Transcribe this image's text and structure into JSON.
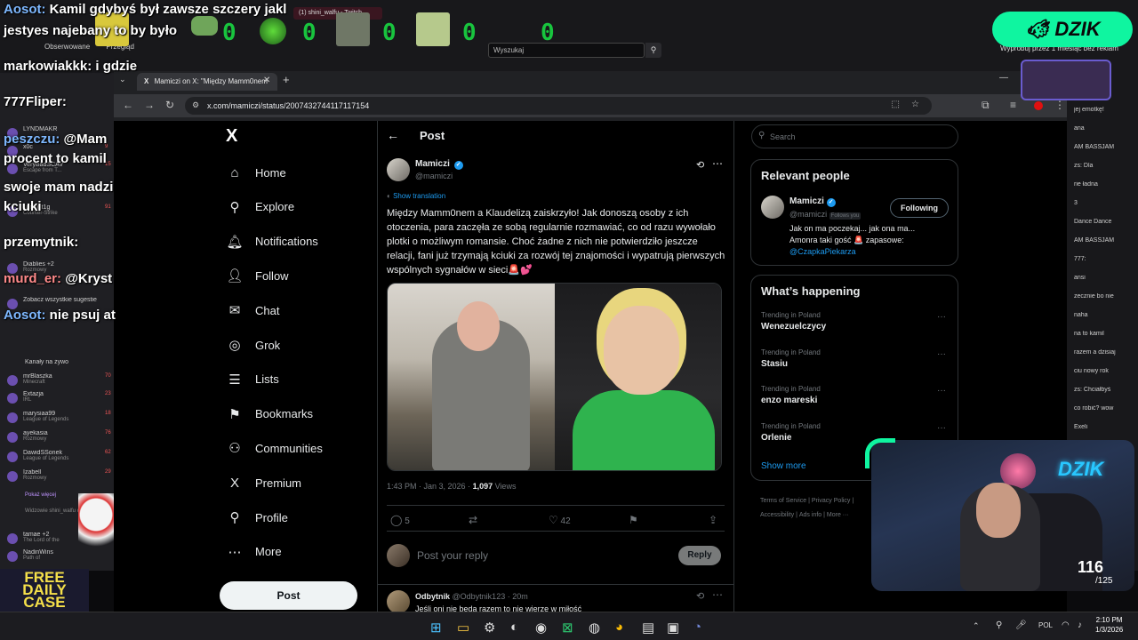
{
  "twitch": {
    "tab_title": "(1) shini_walfu - Twitch",
    "search_placeholder": "Wyszukaj",
    "nav": [
      "Obserwowane",
      "Przegląd"
    ],
    "promo": "Wypróbuj przez 1 miesiąc bez reklam",
    "counter_zeros": [
      "0",
      "0",
      "0",
      "0",
      "0"
    ],
    "left_items": [
      {
        "name": "LYNDMAKR",
        "sub": "",
        "count": ""
      },
      {
        "name": "x0c",
        "sub": "",
        "count": "9"
      },
      {
        "name": "VeryBadSCAV",
        "sub": "Escape from T...",
        "count": "15"
      },
      {
        "name": "summit1g",
        "sub": "Counter-Strike",
        "count": "91"
      },
      {
        "name": "Diablies +2",
        "sub": "Rozmowy",
        "count": ""
      },
      {
        "name": "Zobacz wszystkie sugestie",
        "sub": "",
        "count": ""
      }
    ],
    "channels_header": "Kanały na żywo",
    "channels": [
      {
        "name": "mrBlaszka",
        "sub": "Minecraft",
        "count": "70"
      },
      {
        "name": "Extazja",
        "sub": "IRL",
        "count": "23"
      },
      {
        "name": "marysiaa99",
        "sub": "League of Legends",
        "count": "18"
      },
      {
        "name": "ayekasia",
        "sub": "Rozmowy",
        "count": "76"
      },
      {
        "name": "DawidSSonek",
        "sub": "League of Legends",
        "count": "62"
      },
      {
        "name": "Izabell",
        "sub": "Rozmowy",
        "count": "29"
      }
    ],
    "show_more": "Pokaż więcej",
    "viewers_also": "Widzowie shini_walfu oglądaj też:",
    "extra_items": [
      {
        "name": "tamae +2",
        "sub": "The Lord of the"
      },
      {
        "name": "NadinWins",
        "sub": "Path of"
      }
    ],
    "free_daily_case": [
      "FREE",
      "DAILY",
      "CASE"
    ],
    "right_chat": [
      "jej emotkę!",
      "ana",
      "AM BASSJAM",
      "zs: Dla",
      "rie ładna",
      "3",
      "Dance Dance",
      "AM BASSJAM",
      "777:",
      "ansi",
      "zecznie bo nie",
      "naha",
      "na to kamil",
      "razem a dzisiaj",
      "ciu nowy rok",
      "zs: Chciałbyś",
      "co robić? wow",
      "Exeli"
    ]
  },
  "chat_overlay": [
    {
      "user": "Aosot:",
      "text": " Kamil gdybyś był zawsze szczery jakl",
      "color": "blue"
    },
    {
      "user": "",
      "text": "jestyes najebany to by było",
      "color": ""
    },
    {
      "user": "markowiakkk:",
      "text": " i gdzie",
      "color": ""
    },
    {
      "user": "777Fliper:",
      "text": "",
      "color": ""
    },
    {
      "user": "peszczu:",
      "text": " @Mam",
      "color": "blue"
    },
    {
      "user": "",
      "text": "procent to kamil",
      "color": ""
    },
    {
      "user": "",
      "text": "swoje mam nadzi",
      "color": ""
    },
    {
      "user": "",
      "text": "kciuki",
      "color": ""
    },
    {
      "user": "przemytnik:",
      "text": "",
      "color": ""
    },
    {
      "user": "murd_er:",
      "text": " @Kryst",
      "color": "red"
    },
    {
      "user": "Aosot:",
      "text": " nie psuj at",
      "color": "blue"
    }
  ],
  "browser": {
    "tab_title": "Mamiczi on X: \"Między Mamm0nem",
    "url": "x.com/mamiczi/status/2007432744117117154"
  },
  "x": {
    "nav": [
      {
        "label": "Home",
        "icon": "⌂",
        "name": "home"
      },
      {
        "label": "Explore",
        "icon": "⚲",
        "name": "explore"
      },
      {
        "label": "Notifications",
        "icon": "🔔︎",
        "name": "notifications"
      },
      {
        "label": "Follow",
        "icon": "👤︎",
        "name": "follow"
      },
      {
        "label": "Chat",
        "icon": "✉",
        "name": "chat"
      },
      {
        "label": "Grok",
        "icon": "◎",
        "name": "grok"
      },
      {
        "label": "Lists",
        "icon": "☰",
        "name": "lists"
      },
      {
        "label": "Bookmarks",
        "icon": "⚑",
        "name": "bookmarks"
      },
      {
        "label": "Communities",
        "icon": "⚇",
        "name": "communities"
      },
      {
        "label": "Premium",
        "icon": "X",
        "name": "premium"
      },
      {
        "label": "Profile",
        "icon": "⚲",
        "name": "profile"
      },
      {
        "label": "More",
        "icon": "⋯",
        "name": "more"
      }
    ],
    "post_button": "Post",
    "post_header": "Post",
    "author": {
      "name": "Mamiczi",
      "handle": "@mamiczi"
    },
    "show_translation": "Show translation",
    "tweet_text": "Między Mamm0nem a Klaudelizą zaiskrzyło! Jak donoszą osoby z ich otoczenia, para zaczęła ze sobą regularnie rozmawiać, co od razu wywołało plotki o możliwym romansie. Choć żadne z nich nie potwierdziło jeszcze relacji, fani już trzymają kciuki za rozwój tej znajomości i wypatrują pierwszych wspólnych sygnałów w sieci🚨💕",
    "meta_time": "1:43 PM · Jan 3, 2026 · ",
    "meta_views": "1,097",
    "meta_views_label": " Views",
    "actions": {
      "replies": "5",
      "reposts": "",
      "likes": "42"
    },
    "reply_placeholder": "Post your reply",
    "reply_button": "Reply",
    "reply_preview": {
      "name": "Odbytnik",
      "handle": "@Odbytnik123",
      "time": "· 20m",
      "text": "Jeśli oni nie będą razem to nie wierzę w miłość"
    },
    "search_placeholder": "Search",
    "relevant_title": "Relevant people",
    "relevant": {
      "name": "Mamiczi",
      "handle": "@mamiczi",
      "follows_you": "Follows you",
      "button": "Following",
      "bio": "Jak on ma poczekaj... jak ona ma... Amonra taki gość 🚨 zapasowe:",
      "bio_link": "@CzapkaPiekarza"
    },
    "happening_title": "What’s happening",
    "trends": [
      {
        "sub": "Trending in Poland",
        "name": "Wenezuelczycy"
      },
      {
        "sub": "Trending in Poland",
        "name": "Stasiu"
      },
      {
        "sub": "Trending in Poland",
        "name": "enzo mareski"
      },
      {
        "sub": "Trending in Poland",
        "name": "Orlenie"
      }
    ],
    "show_more": "Show more",
    "footer": [
      "Terms of Service",
      "|",
      "Privacy Policy",
      "|",
      "Accessibility",
      "|",
      "Ads info",
      "|",
      "More ···"
    ]
  },
  "overlay": {
    "dzik": "DZIK",
    "webcam_brand": "DZIK",
    "count": "116",
    "total": "/125"
  },
  "taskbar": {
    "lang": "POL",
    "time": "2:10 PM",
    "date": "1/3/2026"
  }
}
